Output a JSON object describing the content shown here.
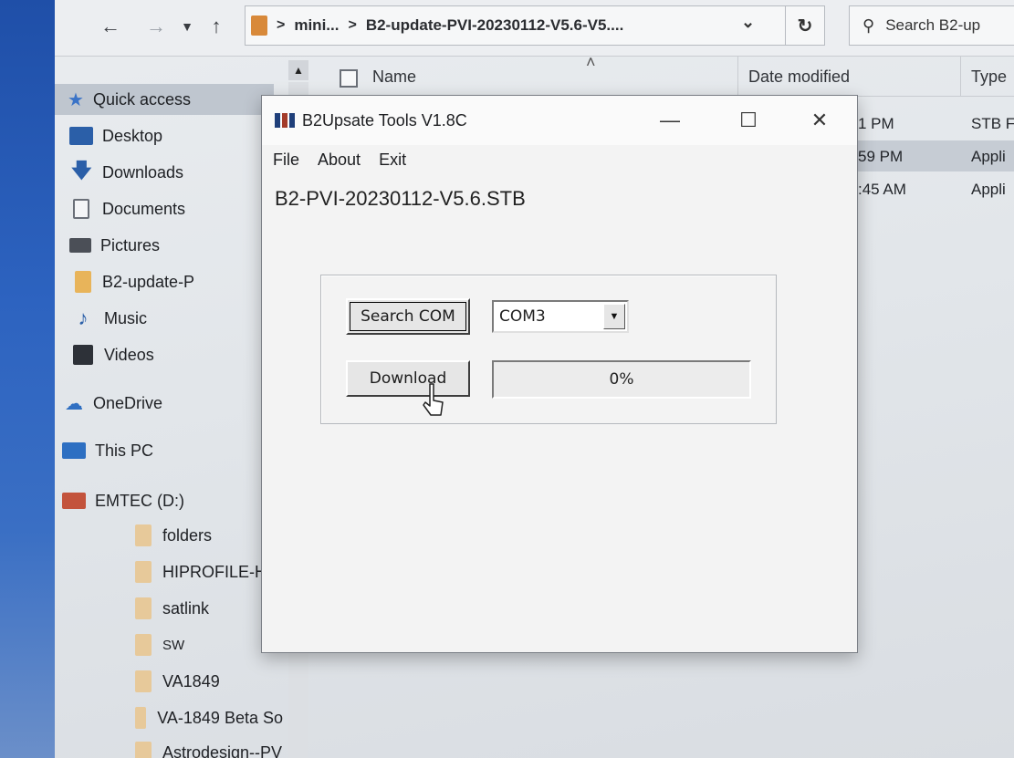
{
  "explorer": {
    "breadcrumb": [
      "mini...",
      "B2-update-PVI-20230112-V5.6-V5...."
    ],
    "search_placeholder": "Search B2-up",
    "columns": {
      "name": "Name",
      "date": "Date modified",
      "type": "Type"
    },
    "files": [
      {
        "date": "1 PM",
        "type": "STB F",
        "selected": false
      },
      {
        "date": "59 PM",
        "type": "Appli",
        "selected": true
      },
      {
        "date": ":45 AM",
        "type": "Appli",
        "selected": false
      }
    ]
  },
  "sidebar": {
    "items": [
      {
        "label": "Quick access",
        "icon": "star-icon"
      },
      {
        "label": "Desktop",
        "icon": "desktop-icon"
      },
      {
        "label": "Downloads",
        "icon": "download-icon"
      },
      {
        "label": "Documents",
        "icon": "documents-icon"
      },
      {
        "label": "Pictures",
        "icon": "pictures-icon"
      },
      {
        "label": "B2-update-P",
        "icon": "folder-icon"
      },
      {
        "label": "Music",
        "icon": "music-icon"
      },
      {
        "label": "Videos",
        "icon": "videos-icon"
      },
      {
        "label": "OneDrive",
        "icon": "onedrive-icon"
      },
      {
        "label": "This PC",
        "icon": "this-pc-icon"
      },
      {
        "label": "EMTEC (D:)",
        "icon": "usb-drive-icon"
      },
      {
        "label": "folders",
        "icon": "folder-icon"
      },
      {
        "label": "HIPROFILE-H",
        "icon": "folder-icon"
      },
      {
        "label": "satlink",
        "icon": "folder-icon"
      },
      {
        "label": "SW",
        "icon": "folder-icon"
      },
      {
        "label": "VA1849",
        "icon": "folder-icon"
      },
      {
        "label": "VA-1849 Beta So",
        "icon": "folder-icon"
      },
      {
        "label": "Astrodesign--PV",
        "icon": "folder-icon"
      }
    ]
  },
  "dialog": {
    "title": "B2Upsate Tools V1.8C",
    "menu": [
      "File",
      "About",
      "Exit"
    ],
    "filename": "B2-PVI-20230112-V5.6.STB",
    "search_button": "Search COM",
    "port_value": "COM3",
    "download_button": "Download",
    "progress_text": "0%",
    "progress": 0
  },
  "colors": {
    "accent": "#2f6fc2",
    "selection": "#c6ccd4"
  }
}
